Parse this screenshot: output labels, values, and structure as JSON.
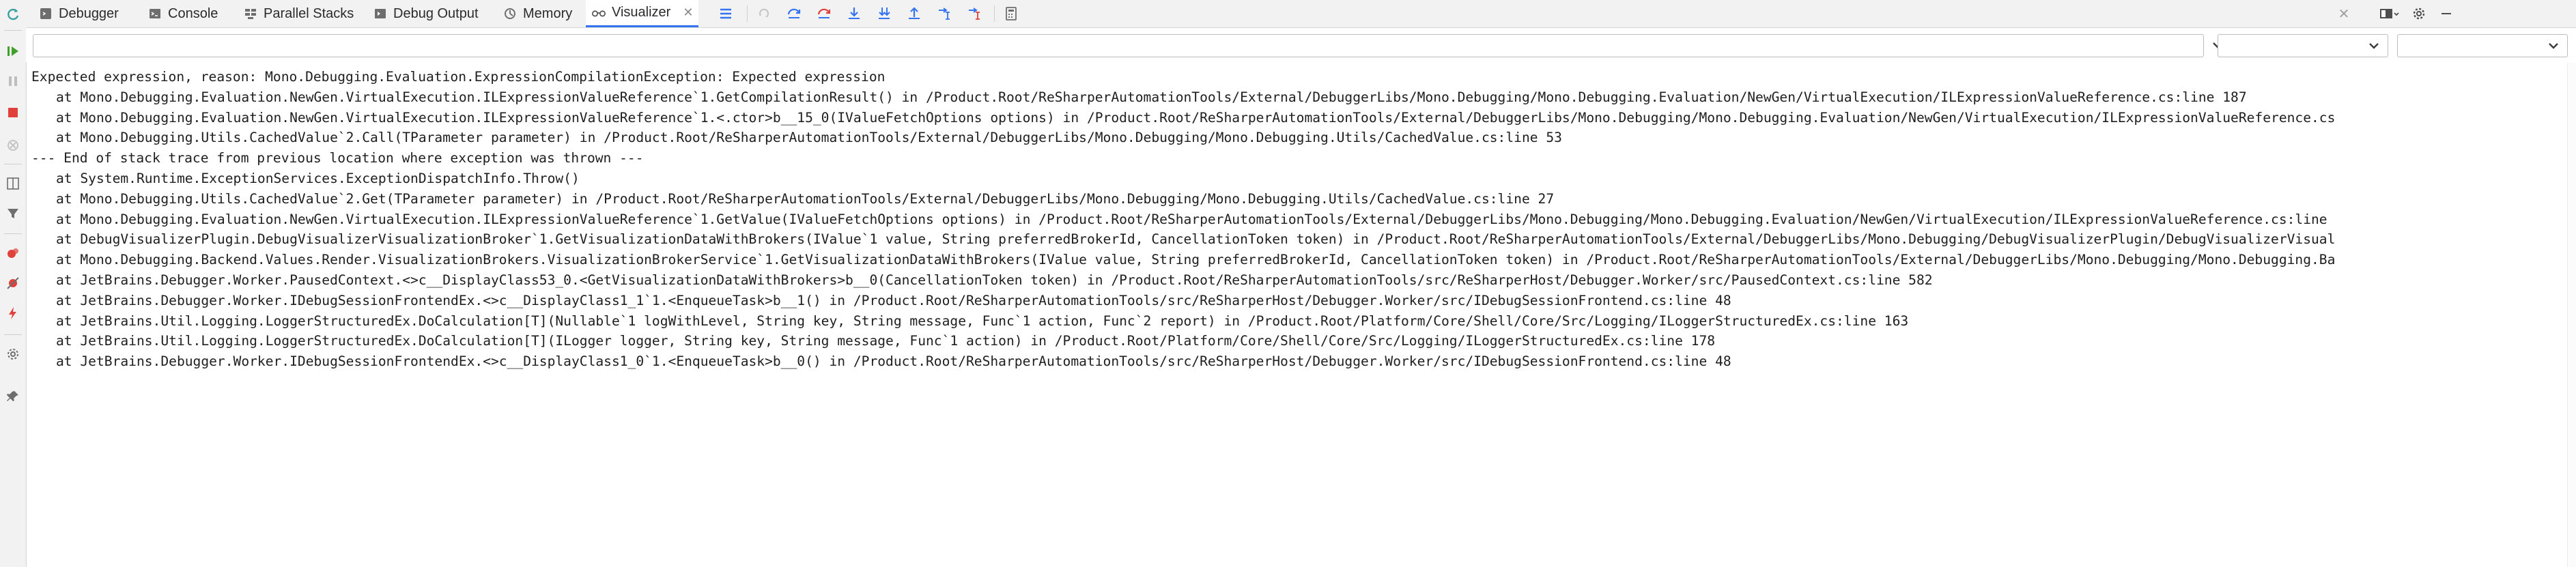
{
  "tabs": [
    {
      "id": "debugger",
      "label": "Debugger",
      "icon": "debugger-icon"
    },
    {
      "id": "console",
      "label": "Console",
      "icon": "console-icon"
    },
    {
      "id": "parallel-stacks",
      "label": "Parallel Stacks",
      "icon": "parallel-stacks-icon"
    },
    {
      "id": "debug-output",
      "label": "Debug Output",
      "icon": "debug-output-icon"
    },
    {
      "id": "memory",
      "label": "Memory",
      "icon": "memory-icon"
    },
    {
      "id": "visualizer",
      "label": "Visualizer",
      "icon": "glasses-icon",
      "active": true
    }
  ],
  "expression": {
    "value": "",
    "placeholder": ""
  },
  "selects": {
    "first": "",
    "second": ""
  },
  "output": {
    "lines": [
      {
        "text": "Expected expression, reason: Mono.Debugging.Evaluation.ExpressionCompilationException: Expected expression",
        "indent": false
      },
      {
        "text": "at Mono.Debugging.Evaluation.NewGen.VirtualExecution.ILExpressionValueReference`1.GetCompilationResult() in /Product.Root/ReSharperAutomationTools/External/DebuggerLibs/Mono.Debugging/Mono.Debugging.Evaluation/NewGen/VirtualExecution/ILExpressionValueReference.cs:line 187",
        "indent": true
      },
      {
        "text": "at Mono.Debugging.Evaluation.NewGen.VirtualExecution.ILExpressionValueReference`1.<.ctor>b__15_0(IValueFetchOptions options) in /Product.Root/ReSharperAutomationTools/External/DebuggerLibs/Mono.Debugging/Mono.Debugging.Evaluation/NewGen/VirtualExecution/ILExpressionValueReference.cs",
        "indent": true
      },
      {
        "text": "at Mono.Debugging.Utils.CachedValue`2.Call(TParameter parameter) in /Product.Root/ReSharperAutomationTools/External/DebuggerLibs/Mono.Debugging/Mono.Debugging.Utils/CachedValue.cs:line 53",
        "indent": true
      },
      {
        "text": "--- End of stack trace from previous location where exception was thrown ---",
        "indent": false
      },
      {
        "text": "at System.Runtime.ExceptionServices.ExceptionDispatchInfo.Throw()",
        "indent": true
      },
      {
        "text": "at Mono.Debugging.Utils.CachedValue`2.Get(TParameter parameter) in /Product.Root/ReSharperAutomationTools/External/DebuggerLibs/Mono.Debugging/Mono.Debugging.Utils/CachedValue.cs:line 27",
        "indent": true
      },
      {
        "text": "at Mono.Debugging.Evaluation.NewGen.VirtualExecution.ILExpressionValueReference`1.GetValue(IValueFetchOptions options) in /Product.Root/ReSharperAutomationTools/External/DebuggerLibs/Mono.Debugging/Mono.Debugging.Evaluation/NewGen/VirtualExecution/ILExpressionValueReference.cs:line",
        "indent": true
      },
      {
        "text": "at DebugVisualizerPlugin.DebugVisualizerVisualizationBroker`1.GetVisualizationDataWithBrokers(IValue`1 value, String preferredBrokerId, CancellationToken token) in /Product.Root/ReSharperAutomationTools/External/DebuggerLibs/Mono.Debugging/DebugVisualizerPlugin/DebugVisualizerVisual",
        "indent": true
      },
      {
        "text": "at Mono.Debugging.Backend.Values.Render.VisualizationBrokers.VisualizationBrokerService`1.GetVisualizationDataWithBrokers(IValue value, String preferredBrokerId, CancellationToken token) in /Product.Root/ReSharperAutomationTools/External/DebuggerLibs/Mono.Debugging/Mono.Debugging.Ba",
        "indent": true
      },
      {
        "text": "at JetBrains.Debugger.Worker.PausedContext.<>c__DisplayClass53_0.<GetVisualizationDataWithBrokers>b__0(CancellationToken token) in /Product.Root/ReSharperAutomationTools/src/ReSharperHost/Debugger.Worker/src/PausedContext.cs:line 582",
        "indent": true
      },
      {
        "text": "at JetBrains.Debugger.Worker.IDebugSessionFrontendEx.<>c__DisplayClass1_1`1.<EnqueueTask>b__1() in /Product.Root/ReSharperAutomationTools/src/ReSharperHost/Debugger.Worker/src/IDebugSessionFrontend.cs:line 48",
        "indent": true
      },
      {
        "text": "at JetBrains.Util.Logging.LoggerStructuredEx.DoCalculation[T](Nullable`1 logWithLevel, String key, String message, Func`1 action, Func`2 report) in /Product.Root/Platform/Core/Shell/Core/Src/Logging/ILoggerStructuredEx.cs:line 163",
        "indent": true
      },
      {
        "text": "at JetBrains.Util.Logging.LoggerStructuredEx.DoCalculation[T](ILogger logger, String key, String message, Func`1 action) in /Product.Root/Platform/Core/Shell/Core/Src/Logging/ILoggerStructuredEx.cs:line 178",
        "indent": true
      },
      {
        "text": "at JetBrains.Debugger.Worker.IDebugSessionFrontendEx.<>c__DisplayClass1_0`1.<EnqueueTask>b__0() in /Product.Root/ReSharperAutomationTools/src/ReSharperHost/Debugger.Worker/src/IDebugSessionFrontend.cs:line 48",
        "indent": true
      }
    ]
  },
  "colors": {
    "accent": "#3574f0",
    "resume_green": "#40a02b",
    "stop_red": "#e0413b"
  }
}
